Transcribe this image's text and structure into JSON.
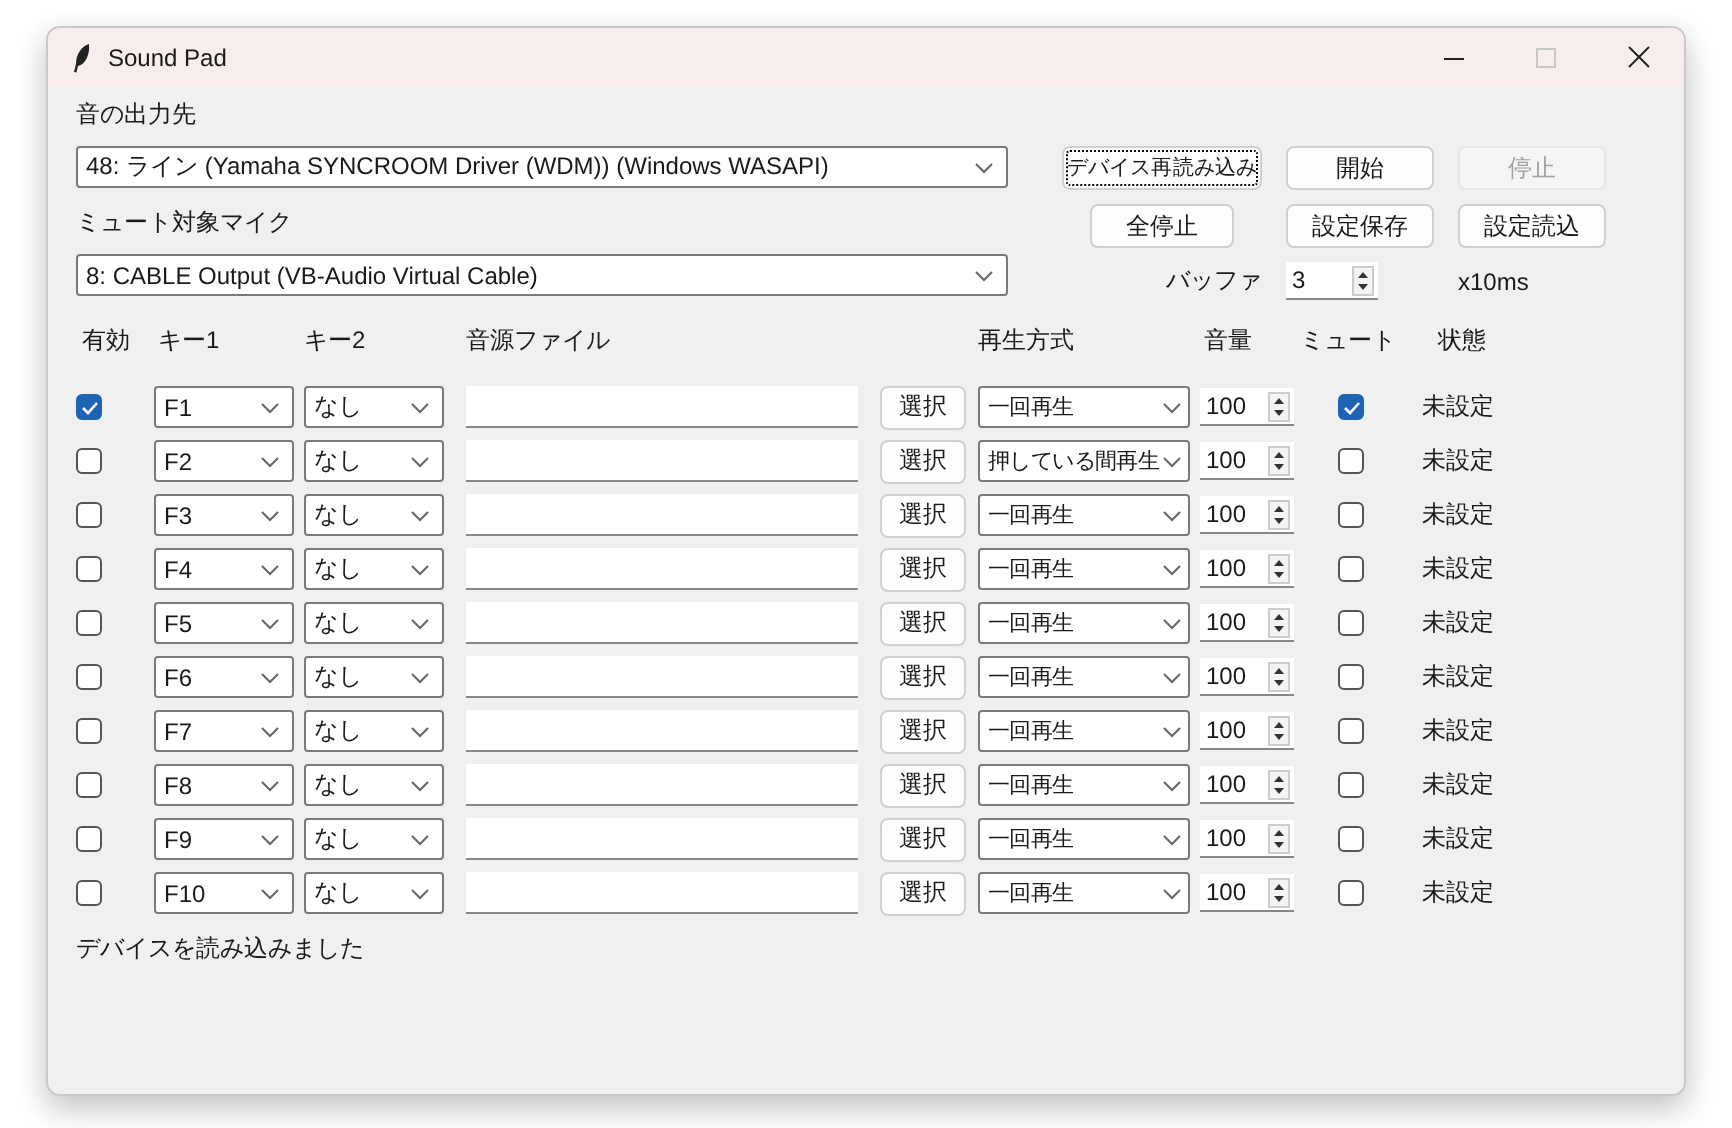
{
  "window": {
    "title": "Sound Pad",
    "maximize_disabled": true
  },
  "output": {
    "label": "音の出力先",
    "value": "48: ライン (Yamaha SYNCROOM Driver (WDM)) (Windows WASAPI)"
  },
  "mic": {
    "label": "ミュート対象マイク",
    "value": "8: CABLE Output (VB-Audio Virtual Cable)"
  },
  "buttons": [
    {
      "label": "デバイス再読み込み",
      "disabled": false,
      "focused": true
    },
    {
      "label": "開始",
      "disabled": false,
      "focused": false
    },
    {
      "label": "停止",
      "disabled": true,
      "focused": false
    },
    {
      "label": "全停止",
      "disabled": false,
      "focused": false
    },
    {
      "label": "設定保存",
      "disabled": false,
      "focused": false
    },
    {
      "label": "設定読込",
      "disabled": false,
      "focused": false
    }
  ],
  "buffer": {
    "label": "バッファ",
    "value": "3",
    "unit": "x10ms"
  },
  "columns": [
    "有効",
    "キー1",
    "キー2",
    "音源ファイル",
    "再生方式",
    "音量",
    "ミュート",
    "状態"
  ],
  "rows": [
    {
      "enabled": true,
      "key1": "F1",
      "key2": "なし",
      "select": "選択",
      "mode": "一回再生",
      "volume": "100",
      "mute": true,
      "status": "未設定"
    },
    {
      "enabled": false,
      "key1": "F2",
      "key2": "なし",
      "select": "選択",
      "mode": "押している間再生",
      "volume": "100",
      "mute": false,
      "status": "未設定"
    },
    {
      "enabled": false,
      "key1": "F3",
      "key2": "なし",
      "select": "選択",
      "mode": "一回再生",
      "volume": "100",
      "mute": false,
      "status": "未設定"
    },
    {
      "enabled": false,
      "key1": "F4",
      "key2": "なし",
      "select": "選択",
      "mode": "一回再生",
      "volume": "100",
      "mute": false,
      "status": "未設定"
    },
    {
      "enabled": false,
      "key1": "F5",
      "key2": "なし",
      "select": "選択",
      "mode": "一回再生",
      "volume": "100",
      "mute": false,
      "status": "未設定"
    },
    {
      "enabled": false,
      "key1": "F6",
      "key2": "なし",
      "select": "選択",
      "mode": "一回再生",
      "volume": "100",
      "mute": false,
      "status": "未設定"
    },
    {
      "enabled": false,
      "key1": "F7",
      "key2": "なし",
      "select": "選択",
      "mode": "一回再生",
      "volume": "100",
      "mute": false,
      "status": "未設定"
    },
    {
      "enabled": false,
      "key1": "F8",
      "key2": "なし",
      "select": "選択",
      "mode": "一回再生",
      "volume": "100",
      "mute": false,
      "status": "未設定"
    },
    {
      "enabled": false,
      "key1": "F9",
      "key2": "なし",
      "select": "選択",
      "mode": "一回再生",
      "volume": "100",
      "mute": false,
      "status": "未設定"
    },
    {
      "enabled": false,
      "key1": "F10",
      "key2": "なし",
      "select": "選択",
      "mode": "一回再生",
      "volume": "100",
      "mute": false,
      "status": "未設定"
    }
  ],
  "status_bar": "デバイスを読み込みました"
}
